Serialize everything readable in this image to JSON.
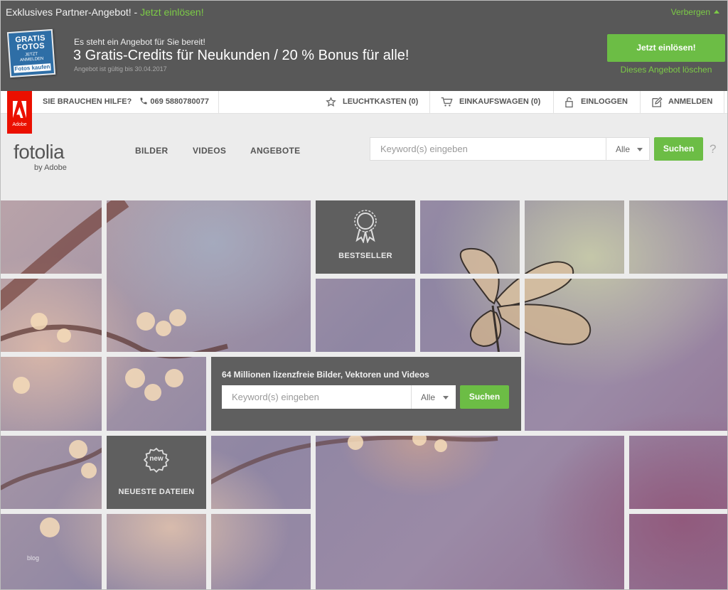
{
  "promo": {
    "top_text": "Exklusives Partner-Angebot! -",
    "top_link": "Jetzt einlösen!",
    "hide_label": "Verbergen",
    "badge": {
      "line1": "GRATIS",
      "line2": "FOTOS",
      "line3": "JETZT",
      "line4": "ANMELDEN",
      "line5": "Fotos kaufen"
    },
    "subtitle": "Es steht ein Angebot für Sie bereit!",
    "headline": "3 Gratis-Credits für Neukunden / 20 % Bonus für alle!",
    "validity": "Angebot ist gültig bis 30.04.2017",
    "cta_label": "Jetzt einlösen!",
    "delete_label": "Dieses Angebot löschen"
  },
  "utility": {
    "adobe_label": "Adobe",
    "help_label": "SIE BRAUCHEN HILFE?",
    "phone": "069 5880780077",
    "lightbox": "LEUCHTKASTEN (0)",
    "cart": "EINKAUFSWAGEN (0)",
    "login": "EINLOGGEN",
    "register": "ANMELDEN"
  },
  "header": {
    "logo": "fotolia",
    "logo_sub": "by Adobe",
    "nav": [
      "BILDER",
      "VIDEOS",
      "ANGEBOTE"
    ],
    "search_placeholder": "Keyword(s) eingeben",
    "filter_value": "Alle",
    "search_button": "Suchen",
    "help_icon": "?"
  },
  "hero": {
    "bestseller_label": "BESTSELLER",
    "newest_badge": "new",
    "newest_label": "NEUESTE DATEIEN",
    "panel_title": "64 Millionen lizenzfreie Bilder, Vektoren und Videos",
    "search_placeholder": "Keyword(s) eingeben",
    "filter_value": "Alle",
    "search_button": "Suchen",
    "watermark": "blog"
  },
  "colors": {
    "accent_green": "#6cbd45",
    "promo_bg": "#585858",
    "adobe_red": "#eb1000",
    "tile_dark": "#5f5f5f"
  },
  "icons": [
    "phone-icon",
    "star-icon",
    "cart-icon",
    "lock-icon",
    "edit-icon",
    "ribbon-icon",
    "new-badge-icon",
    "butterfly-image"
  ]
}
